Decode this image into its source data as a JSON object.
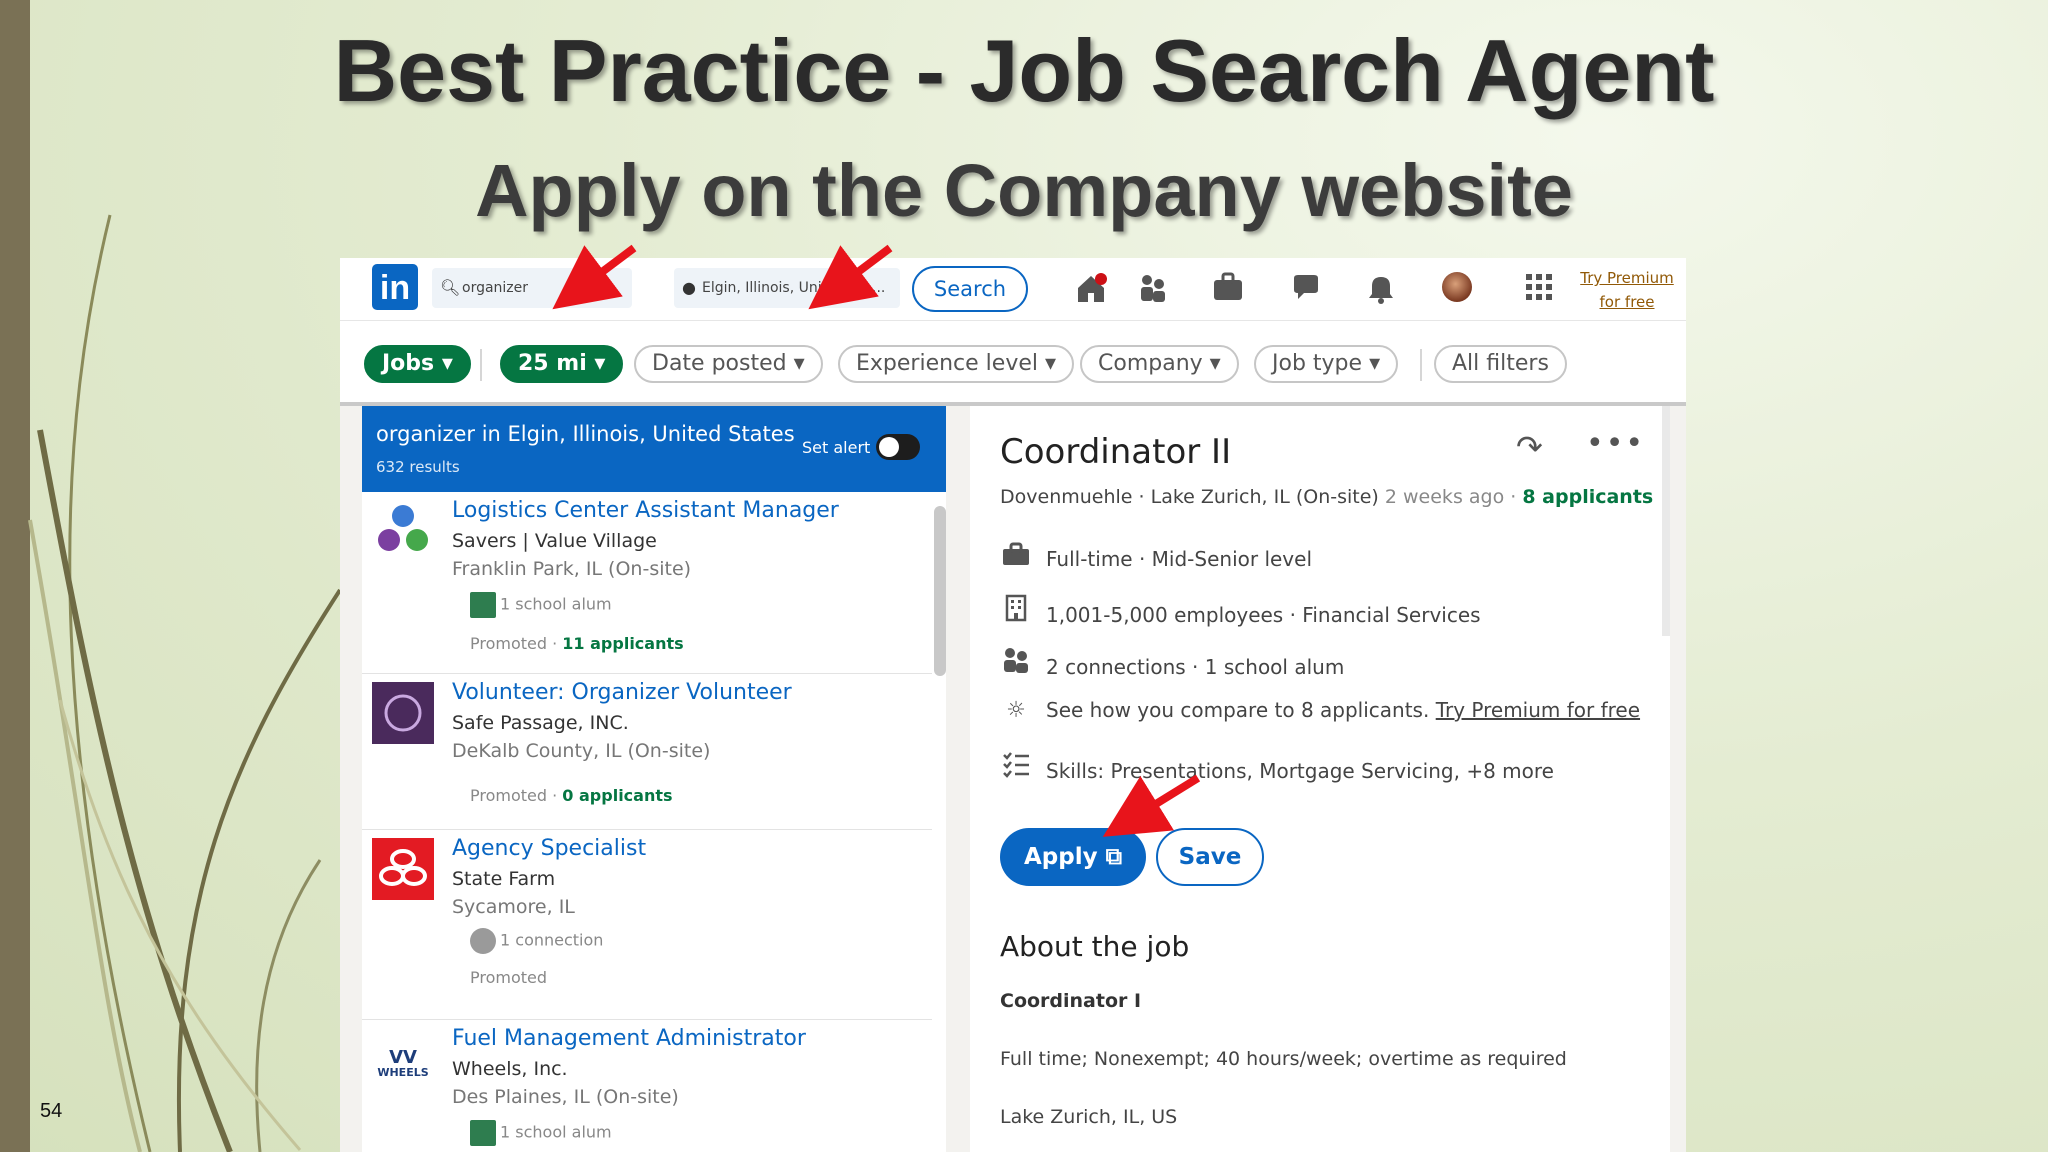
{
  "slide": {
    "title": "Best Practice - Job Search Agent",
    "subtitle": "Apply on the Company website",
    "page_number": "54"
  },
  "topbar": {
    "logo": "in",
    "search_keyword": "organizer",
    "search_location": "Elgin, Illinois, United Sta...",
    "search_button": "Search",
    "premium_line1": "Try Premium",
    "premium_line2": "for free",
    "icons": [
      "home-icon",
      "network-icon",
      "jobs-icon",
      "messaging-icon",
      "notifications-icon",
      "avatar",
      "apps-grid-icon"
    ]
  },
  "filters": {
    "jobs": "Jobs",
    "distance": "25 mi",
    "date_posted": "Date posted",
    "experience": "Experience level",
    "company": "Company",
    "job_type": "Job type",
    "all_filters": "All filters"
  },
  "results": {
    "header": "organizer in Elgin, Illinois, United States",
    "count": "632 results",
    "set_alert": "Set alert",
    "jobs": [
      {
        "title": "Logistics Center Assistant Manager",
        "company": "Savers | Value Village",
        "location": "Franklin Park, IL (On-site)",
        "insight": "1 school alum",
        "promoted": "Promoted ·",
        "applicants": "11 applicants"
      },
      {
        "title": "Volunteer: Organizer Volunteer",
        "company": "Safe Passage, INC.",
        "location": "DeKalb County, IL (On-site)",
        "insight": "",
        "promoted": "Promoted ·",
        "applicants": "0 applicants"
      },
      {
        "title": "Agency Specialist",
        "company": "State Farm",
        "location": "Sycamore, IL",
        "insight": "1 connection",
        "promoted": "Promoted",
        "applicants": ""
      },
      {
        "title": "Fuel Management Administrator",
        "company": "Wheels, Inc.",
        "location": "Des Plaines, IL (On-site)",
        "insight": "1 school alum",
        "promoted": "",
        "applicants": "",
        "logo_text": "WHEELS"
      }
    ]
  },
  "detail": {
    "title": "Coordinator II",
    "company": "Dovenmuehle ·",
    "location": "Lake Zurich, IL (On-site)",
    "posted": "2 weeks ago ·",
    "applicants": "8 applicants",
    "info": [
      "Full-time · Mid-Senior level",
      "1,001-5,000 employees · Financial Services",
      "2 connections · 1 school alum",
      "See how you compare to 8 applicants.",
      "Skills: Presentations, Mortgage Servicing, +8 more"
    ],
    "premium_link": "Try Premium for free",
    "apply": "Apply",
    "save": "Save",
    "about_heading": "About the job",
    "about_title": "Coordinator I",
    "about_line1": "Full time; Nonexempt; 40 hours/week; overtime as required",
    "about_line2": "Lake Zurich, IL, US"
  },
  "colors": {
    "linkedin_blue": "#0a66c2",
    "green": "#057642",
    "arrow_red": "#e8141b",
    "slide_bg": "#e4ecd2"
  }
}
